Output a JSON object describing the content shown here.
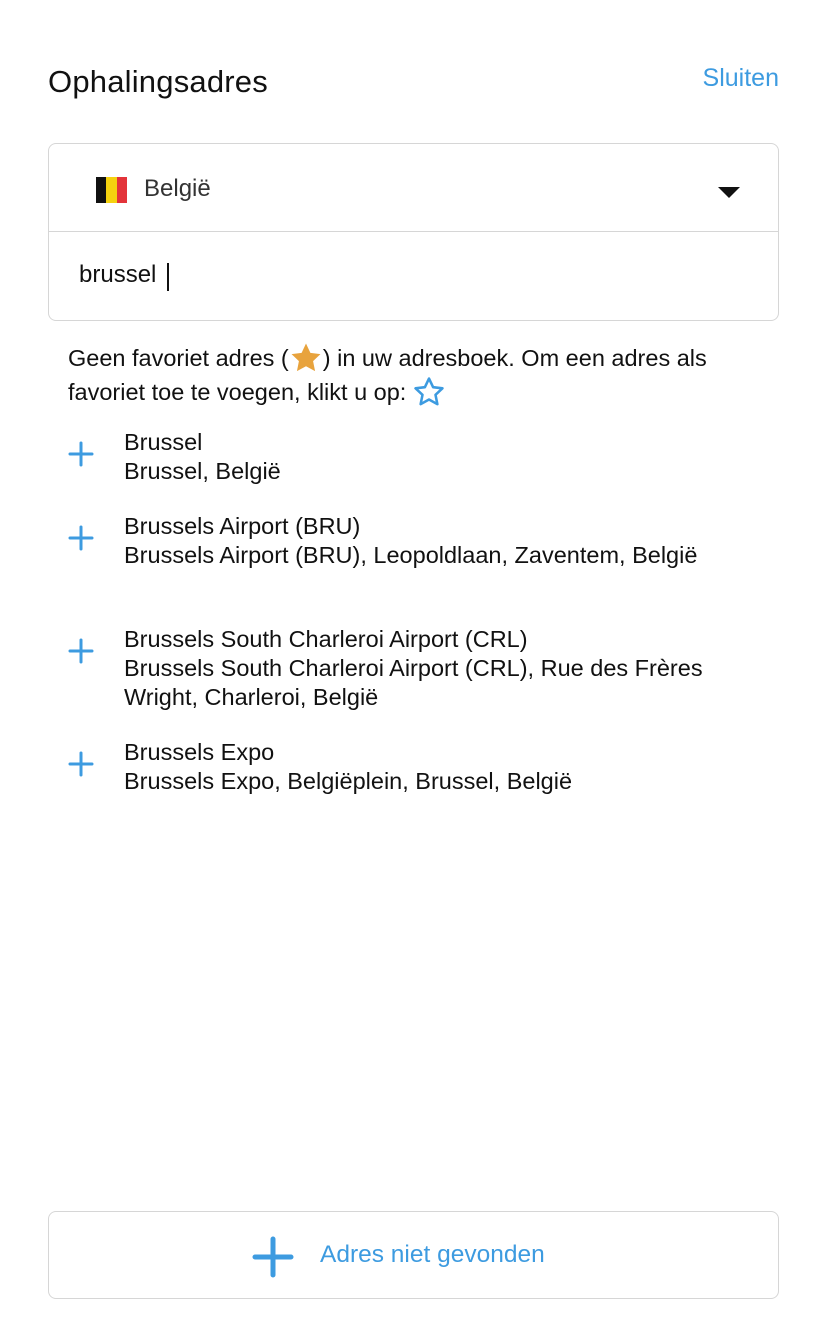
{
  "header": {
    "title": "Ophalingsadres",
    "close_label": "Sluiten"
  },
  "country": {
    "name": "België",
    "flag_colors": [
      "#111111",
      "#f5d20f",
      "#e3343a"
    ]
  },
  "search": {
    "value": "brussel"
  },
  "info": {
    "part1": "Geen favoriet adres (",
    "part2": ") in uw adresboek. Om een adres als favoriet toe te voegen, klikt u op:"
  },
  "results": [
    {
      "title": "Brussel",
      "address": "Brussel, België"
    },
    {
      "title": "Brussels Airport (BRU)",
      "address": "Brussels Airport (BRU), Leopoldlaan, Zaventem, België"
    },
    {
      "title": "Brussels South Charleroi Airport (CRL)",
      "address": "Brussels South Charleroi Airport (CRL), Rue des Frères Wright, Charleroi, België"
    },
    {
      "title": "Brussels Expo",
      "address": "Brussels Expo, Belgiëplein, Brussel, België"
    }
  ],
  "bottom_button": {
    "label": "Adres niet gevonden"
  },
  "colors": {
    "accent": "#3d9be0",
    "star_fill": "#e8a33d",
    "border": "#d6d6d6"
  }
}
